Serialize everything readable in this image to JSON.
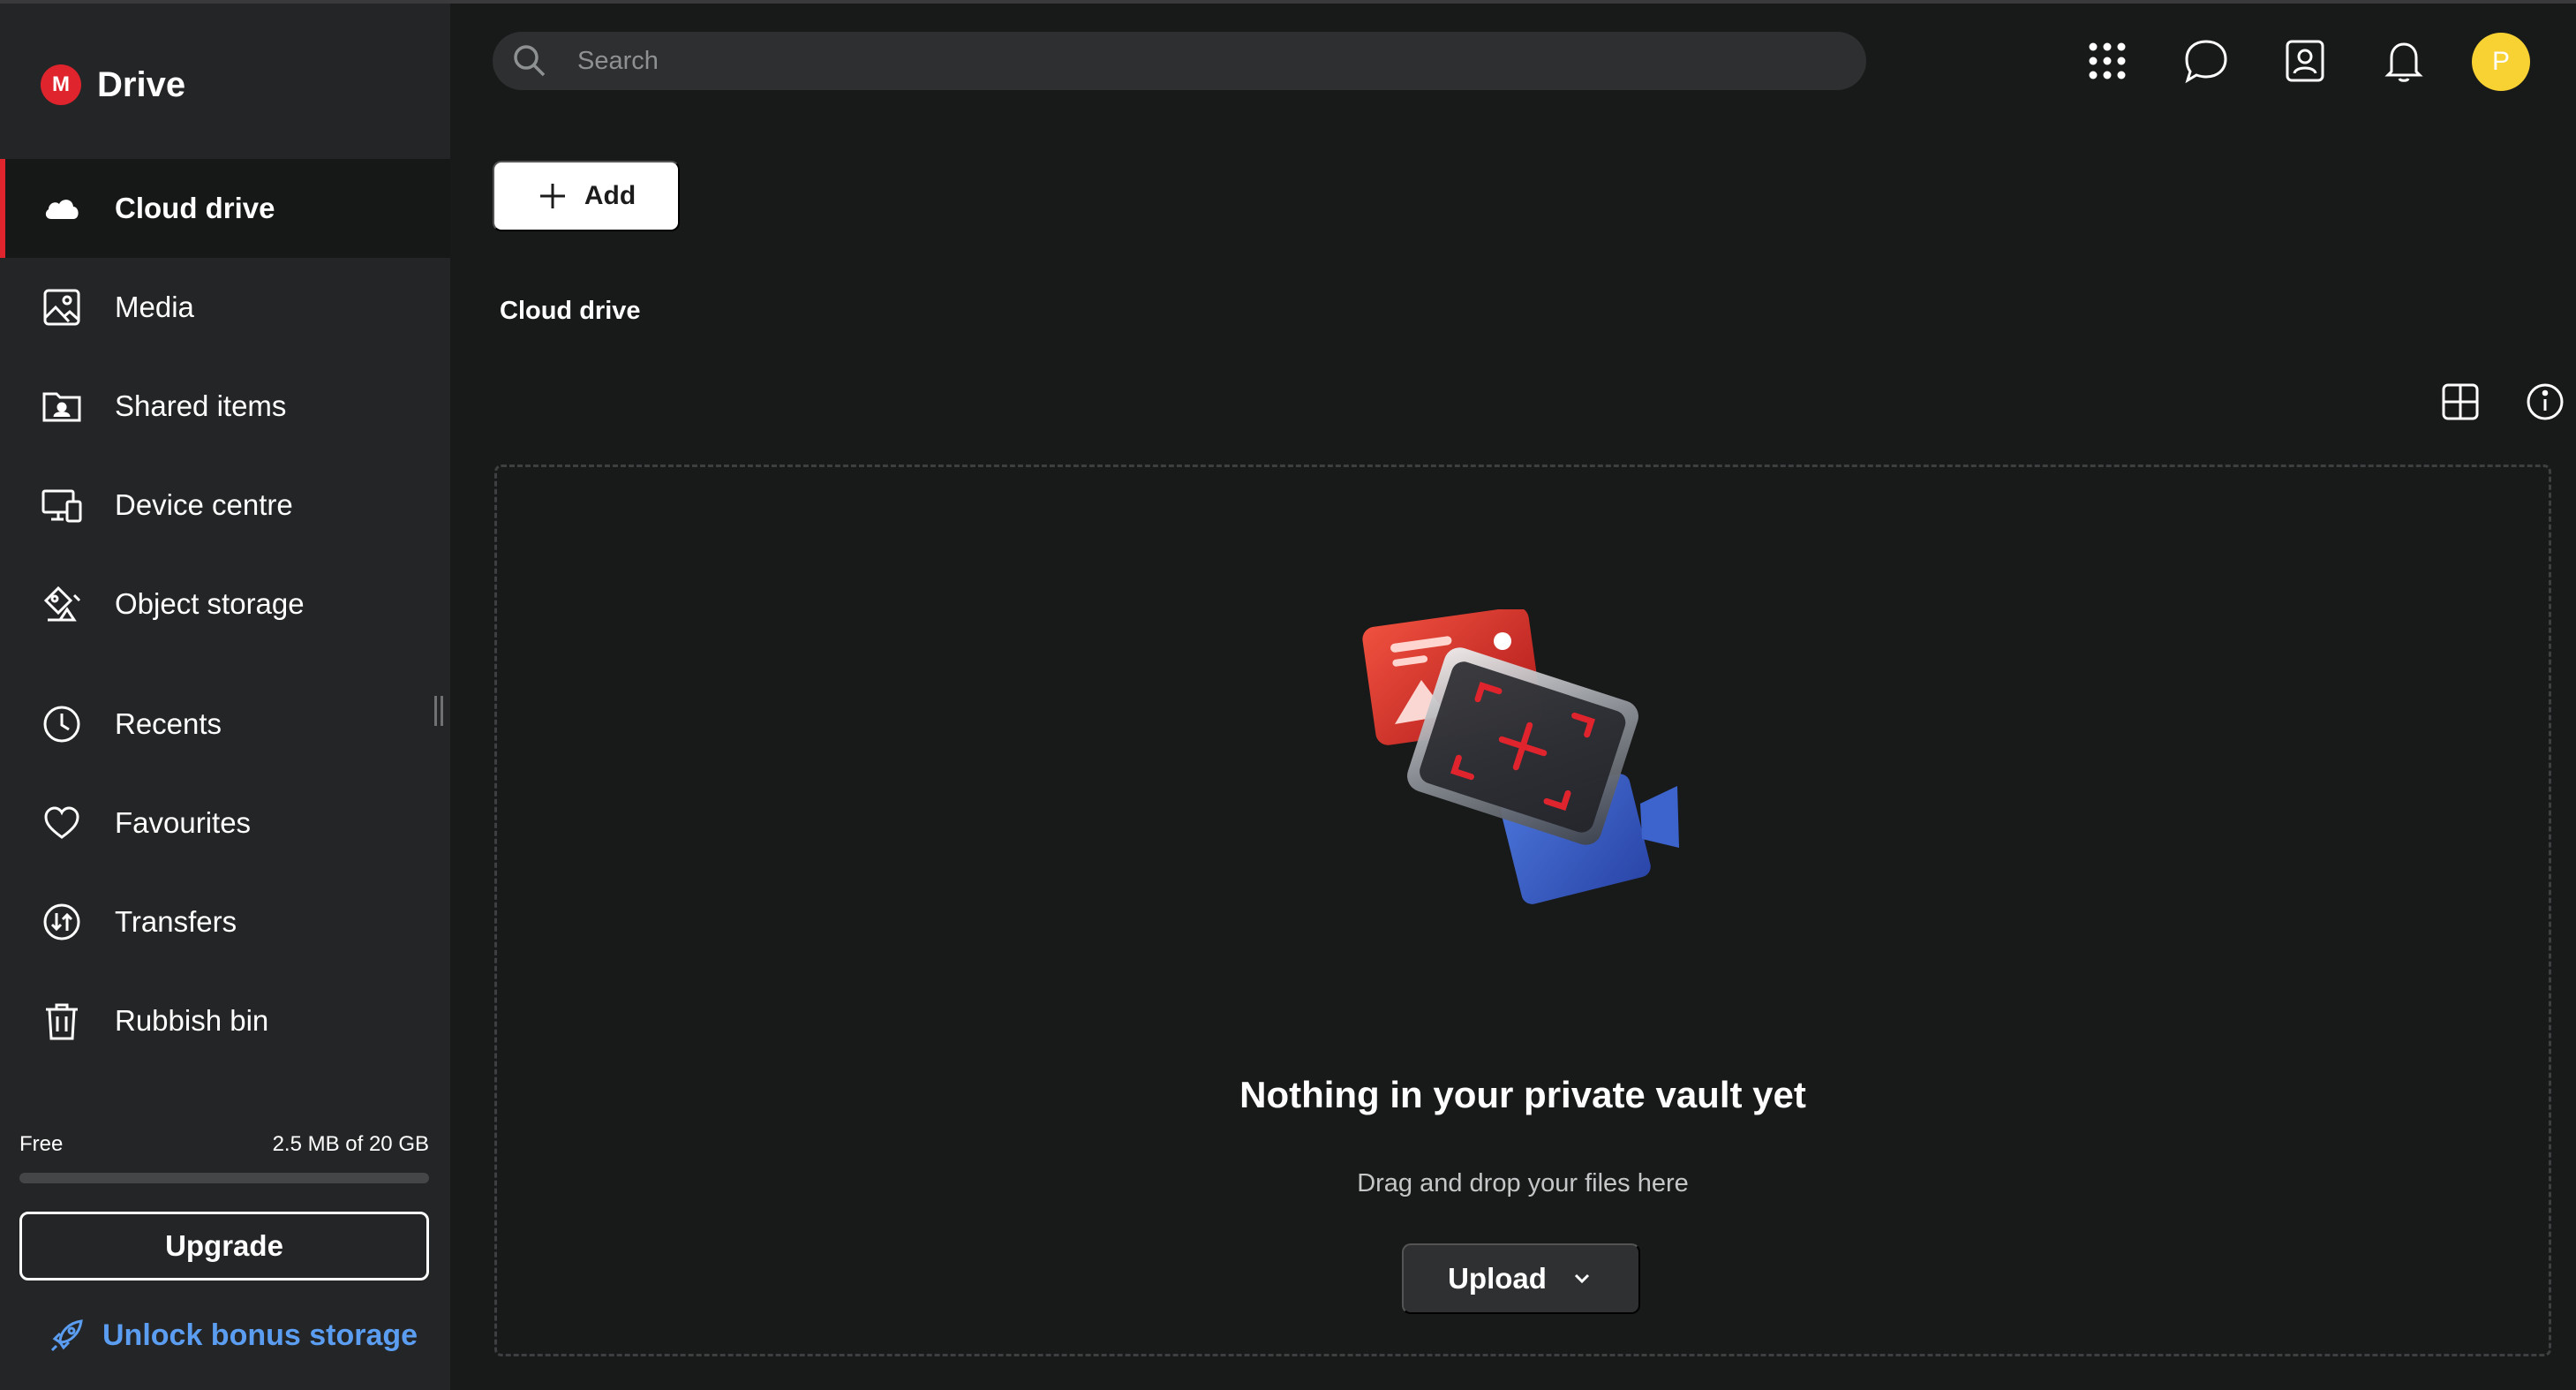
{
  "app": {
    "name": "Drive",
    "logo_letter": "M",
    "brand_color": "#e0242e"
  },
  "sidebar": {
    "items": [
      {
        "label": "Cloud drive",
        "icon": "cloud-icon",
        "active": true
      },
      {
        "label": "Media",
        "icon": "image-icon"
      },
      {
        "label": "Shared items",
        "icon": "shared-folder-icon"
      },
      {
        "label": "Device centre",
        "icon": "devices-icon"
      },
      {
        "label": "Object storage",
        "icon": "object-storage-icon"
      },
      {
        "label": "Recents",
        "icon": "clock-icon"
      },
      {
        "label": "Favourites",
        "icon": "heart-icon"
      },
      {
        "label": "Transfers",
        "icon": "transfers-icon"
      },
      {
        "label": "Rubbish bin",
        "icon": "trash-icon"
      }
    ],
    "storage": {
      "plan": "Free",
      "usage": "2.5 MB of 20 GB",
      "used_fraction": 0.0
    },
    "upgrade_label": "Upgrade",
    "bonus_label": "Unlock bonus storage",
    "bonus_color": "#5b9df0"
  },
  "topbar": {
    "search_placeholder": "Search",
    "icons": [
      "apps-grid-icon",
      "chat-icon",
      "contacts-icon",
      "bell-icon"
    ],
    "avatar_initial": "P",
    "avatar_color": "#f8d132"
  },
  "main": {
    "add_label": "Add",
    "title": "Cloud drive",
    "view_icons": [
      "grid-view-icon",
      "info-icon"
    ],
    "empty_title": "Nothing in your private vault yet",
    "empty_subtitle": "Drag and drop your files here",
    "upload_label": "Upload"
  }
}
